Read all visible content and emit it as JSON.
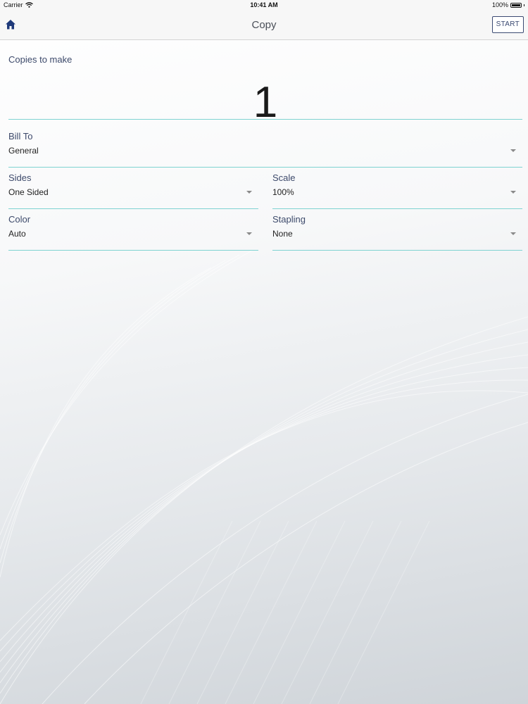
{
  "status_bar": {
    "carrier": "Carrier",
    "time": "10:41 AM",
    "battery": "100%",
    "battery_level": 1.0
  },
  "nav": {
    "title": "Copy",
    "start_label": "START",
    "home_icon": "home-icon"
  },
  "copies": {
    "label": "Copies to make",
    "value": "1"
  },
  "fields": {
    "bill_to": {
      "label": "Bill To",
      "value": "General"
    },
    "sides": {
      "label": "Sides",
      "value": "One Sided"
    },
    "scale": {
      "label": "Scale",
      "value": "100%"
    },
    "color": {
      "label": "Color",
      "value": "Auto"
    },
    "stapling": {
      "label": "Stapling",
      "value": "None"
    }
  },
  "colors": {
    "accent_line": "#7fd3d1",
    "label_text": "#3d4a6b",
    "home_icon": "#1f3a7a"
  }
}
